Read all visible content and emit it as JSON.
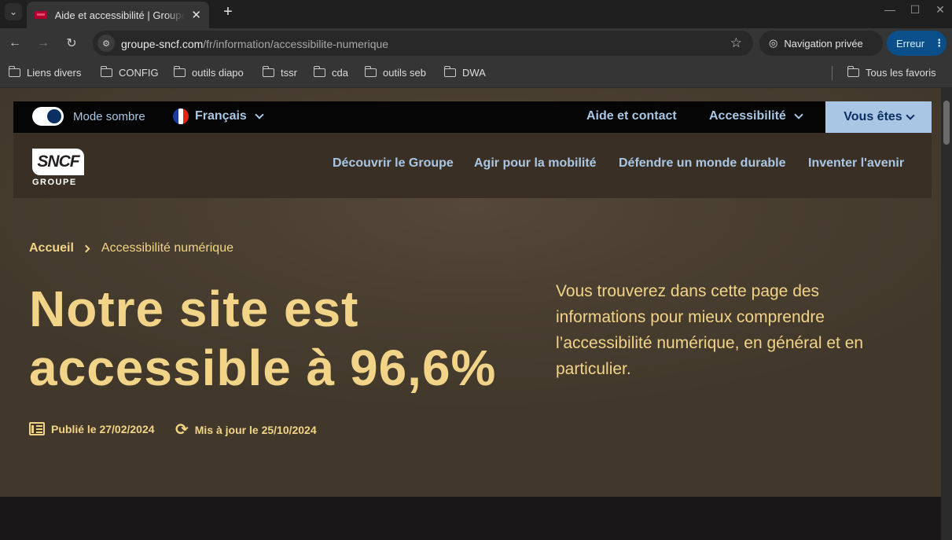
{
  "browser": {
    "tab_title": "Aide et accessibilité | Groupe SNCF",
    "tab_list_icon": "chevron-down-icon",
    "new_tab_symbol": "+",
    "window_controls": [
      "—",
      "☐",
      "✕"
    ],
    "url_host": "groupe-sncf.com",
    "url_path": "/fr/information/accessibilite-numerique",
    "private_label": "Navigation privée",
    "error_label": "Erreur",
    "bookmarks": [
      "Liens divers",
      "CONFIG",
      "outils diapo",
      "tssr",
      "cda",
      "outils seb",
      "DWA"
    ],
    "all_bookmarks_label": "Tous les favoris"
  },
  "topbar": {
    "dark_mode_label": "Mode sombre",
    "dark_mode_on": true,
    "language_label": "Français",
    "help_label": "Aide et contact",
    "accessibility_label": "Accessibilité",
    "you_are_label": "Vous êtes"
  },
  "logo": {
    "mark": "SNCF",
    "sub": "GROUPE"
  },
  "mainnav": {
    "items": [
      "Découvrir le Groupe",
      "Agir pour la mobilité",
      "Défendre un monde durable",
      "Inventer l'avenir"
    ]
  },
  "breadcrumb": {
    "home": "Accueil",
    "current": "Accessibilité numérique"
  },
  "hero": {
    "title_line1": "Notre site est",
    "title_line2": "accessible à 96,6%",
    "description": "Vous trouverez dans cette page des informations pour mieux comprendre l’accessibilité numérique, en général et en particulier.",
    "published": "Publié le 27/02/2024",
    "updated": "Mis à jour le 25/10/2024"
  },
  "colors": {
    "accent_gold": "#f2d488",
    "link_blue": "#a9c7e4",
    "navy": "#0c2f63",
    "hero_bg": "#4a3f31"
  }
}
